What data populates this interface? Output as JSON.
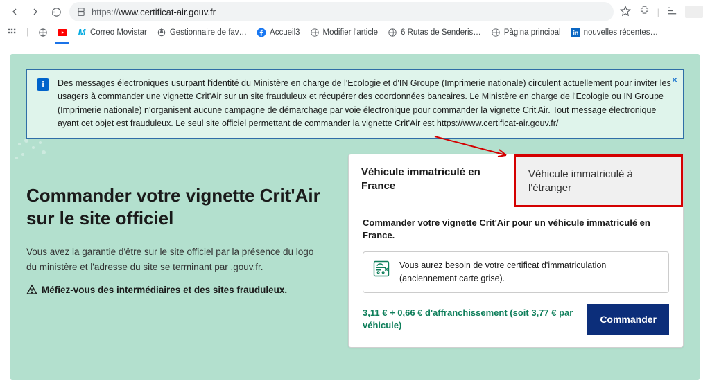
{
  "browser": {
    "url_scheme": "https://",
    "url_rest": "www.certificat-air.gouv.fr"
  },
  "bookmarks": {
    "b1": "Correo Movistar",
    "b2": "Gestionnaire de fav…",
    "b3": "Accueil3",
    "b4": "Modifier l'article",
    "b5": "6 Rutas de Senderis…",
    "b6": "Pàgina principal",
    "b7": "nouvelles récentes…"
  },
  "alert": {
    "badge": "i",
    "text": "Des messages électroniques usurpant l'identité du Ministère en charge de l'Ecologie et d'IN Groupe (Imprimerie nationale) circulent actuellement pour inviter les usagers à commander une vignette Crit'Air sur un site frauduleux et récupérer des coordonnées bancaires. Le Ministère en charge de l'Ecologie ou IN Groupe (Imprimerie nationale) n'organisent aucune campagne de démarchage par voie électronique pour commander la vignette Crit'Air. Tout message électronique ayant cet objet est frauduleux. Le seul site officiel permettant de commander la vignette Crit'Air est https://www.certificat-air.gouv.fr/",
    "close": "×"
  },
  "left": {
    "title": "Commander votre vignette Crit'Air sur le site officiel",
    "p1": "Vous avez la garantie d'être sur le site officiel par la présence du logo du ministère et l'adresse du site se terminant par .gouv.fr.",
    "warn": "Méfiez-vous des intermédiaires et des sites frauduleux."
  },
  "card": {
    "tab_france": "Véhicule immatriculé en France",
    "tab_foreign": "Véhicule immatriculé à l'étranger",
    "subtitle": "Commander votre vignette Crit'Air pour un véhicule immatriculé en France.",
    "need_text": "Vous aurez besoin de votre certificat d'immatriculation (anciennement carte grise).",
    "price": "3,11 € + 0,66 € d'affranchissement (soit 3,77 € par véhicule)",
    "order": "Commander"
  }
}
